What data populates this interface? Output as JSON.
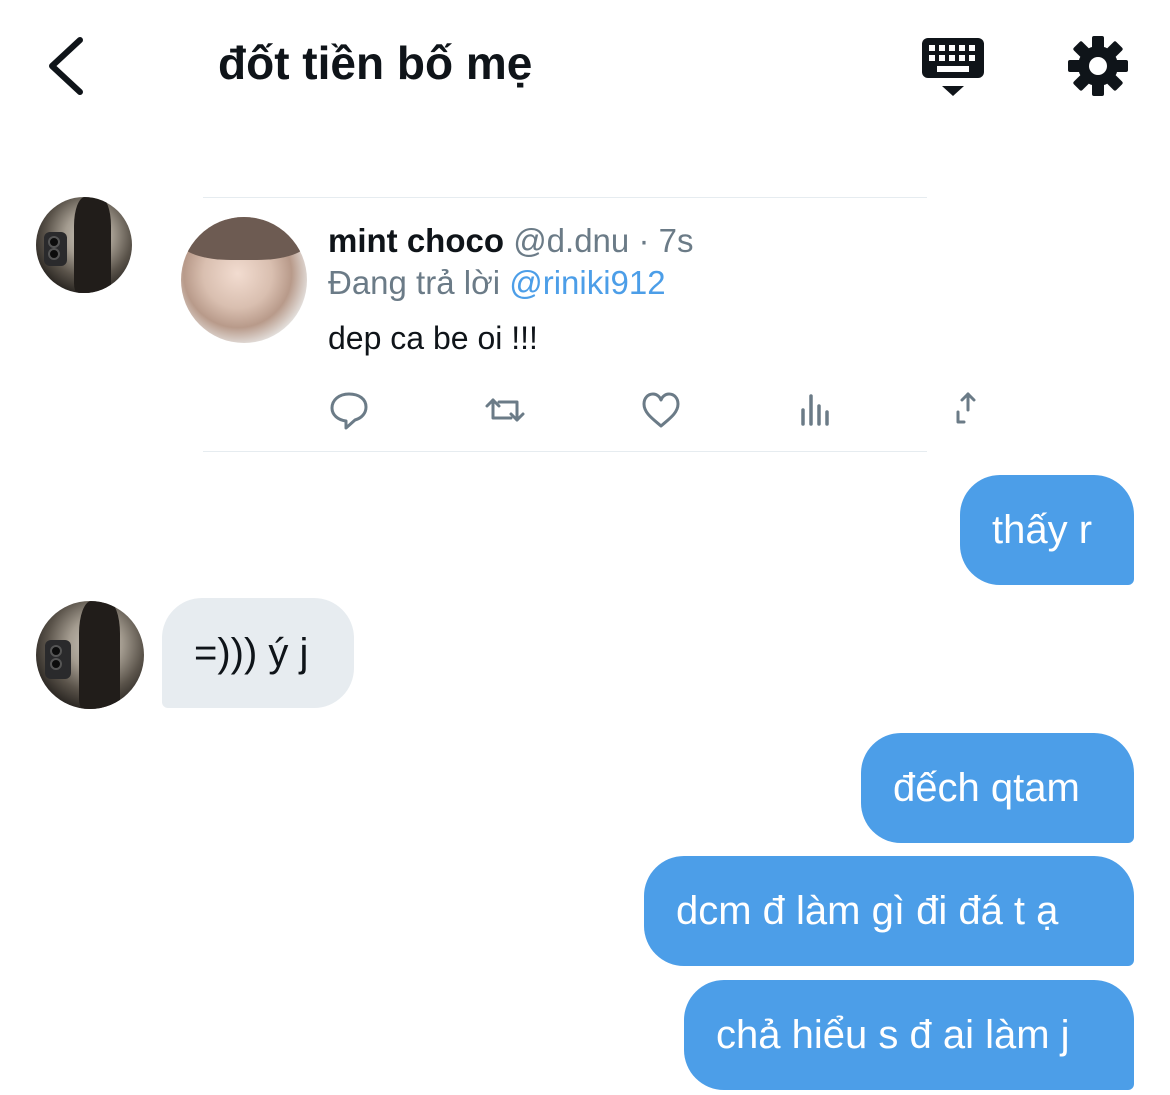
{
  "header": {
    "back_icon": "chevron-left-icon",
    "title": "đốt tiền bố mẹ",
    "keyboard_icon": "keyboard-icon",
    "settings_icon": "gear-icon"
  },
  "shared_tweet": {
    "name": "mint choco",
    "handle": "@d.dnu",
    "separator": "·",
    "time": "7s",
    "reply_prefix": "Đang trả lời",
    "reply_handle": "@riniki912",
    "text": "dep ca be oi !!!",
    "actions": [
      "reply-icon",
      "retweet-icon",
      "like-icon",
      "views-icon",
      "share-icon"
    ]
  },
  "messages": [
    {
      "direction": "outgoing",
      "text": "thấy r"
    },
    {
      "direction": "incoming",
      "text": "=))) ý j"
    },
    {
      "direction": "outgoing",
      "text": "đếch qtam"
    },
    {
      "direction": "outgoing",
      "text": "dcm đ làm gì đi đá t ạ"
    },
    {
      "direction": "outgoing",
      "text": "chả hiểu s đ ai làm j"
    }
  ],
  "colors": {
    "accent": "#4c9ee8",
    "incoming_bubble": "#e7ecf0",
    "text_primary": "#0f1419",
    "text_secondary": "#6b7b87"
  }
}
